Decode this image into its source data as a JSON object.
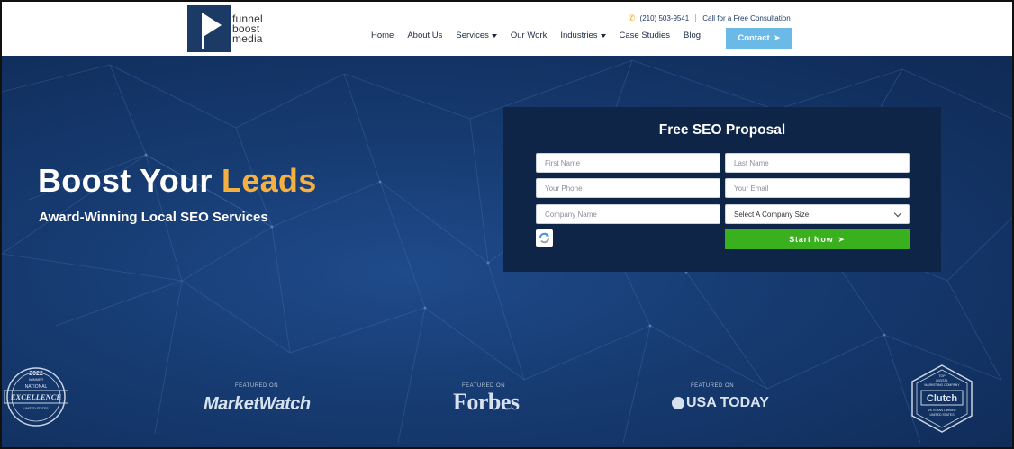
{
  "header": {
    "logo": {
      "line1": "funnel",
      "line2": "boost",
      "line3": "media"
    },
    "phone_icon": "phone-icon",
    "phone": "(210) 503-9541",
    "consult": "Call for a Free Consultation",
    "nav": [
      "Home",
      "About Us",
      "Services",
      "Our Work",
      "Industries",
      "Case Studies",
      "Blog"
    ],
    "contact_label": "Contact",
    "contact_icon": "arrow-right-icon"
  },
  "hero": {
    "headline_main": "Boost Your",
    "headline_accent": "Leads",
    "subhead": "Award-Winning Local SEO Services"
  },
  "form": {
    "title": "Free SEO Proposal",
    "first_name_placeholder": "First Name",
    "last_name_placeholder": "Last Name",
    "phone_placeholder": "Your Phone",
    "email_placeholder": "Your Email",
    "company_placeholder": "Company Name",
    "company_size_selected": "Select A Company Size",
    "submit_label": "Start Now",
    "submit_icon": "paper-plane-icon"
  },
  "featured": {
    "label": "FEATURED ON",
    "brands": [
      "MarketWatch",
      "Forbes",
      "USA TODAY"
    ]
  },
  "badges": {
    "left": {
      "year": "2022",
      "word": "WINNER",
      "line1": "NATIONAL",
      "line2": "EXCELLENCE",
      "line3": "UNITED STATES"
    },
    "right": {
      "top1": "TOP",
      "top2": "DIGITAL",
      "top3": "MARKETING COMPANY",
      "brand": "Clutch",
      "bottom1": "VETERAN OWNED",
      "bottom2": "UNITED STATES"
    }
  },
  "colors": {
    "navy": "#1b3a66",
    "accent": "#f5b041",
    "contact": "#6ab9e6",
    "submit": "#3ab01e"
  }
}
